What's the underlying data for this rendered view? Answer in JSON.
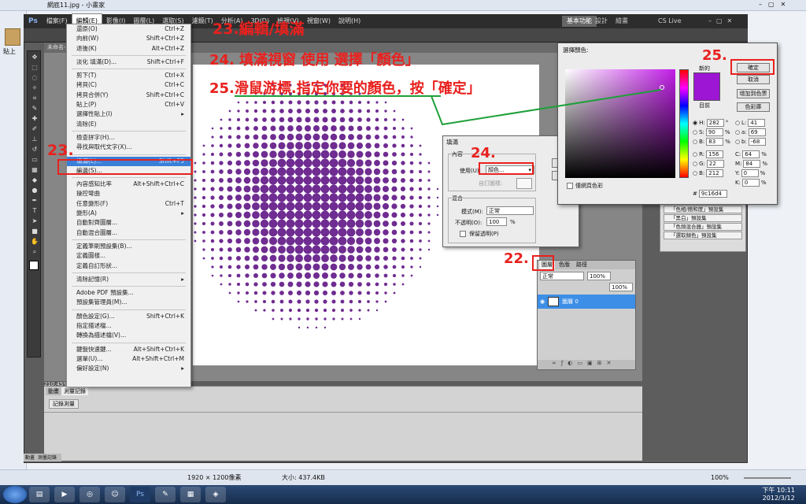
{
  "paint": {
    "title": "網底11.jpg - 小畫家",
    "status_size": "1920 × 1200像素",
    "status_filesize": "大小: 437.4KB",
    "zoom": "100%",
    "paste_label": "貼上"
  },
  "photoshop": {
    "logo": "Ps",
    "menus": [
      "檔案(F)",
      "編輯(E)",
      "影像(I)",
      "圖層(L)",
      "選取(S)",
      "濾鏡(T)",
      "分析(A)",
      "3D(D)",
      "檢視(V)",
      "視窗(W)",
      "說明(H)"
    ],
    "workspaces": [
      "基本功能",
      "設計",
      "繪畫"
    ],
    "cslive": "CS Live",
    "doc_tab": "未命名-1",
    "zoom_status": "210.45%",
    "lower_tabs": [
      "動畫",
      "測量記錄"
    ],
    "record_label": "記錄測量",
    "bottom_tabs": [
      "動畫",
      "測量記錄"
    ]
  },
  "edit_menu": [
    {
      "label": "還原(O)",
      "shortcut": "Ctrl+Z"
    },
    {
      "label": "向前(W)",
      "shortcut": "Shift+Ctrl+Z"
    },
    {
      "label": "退後(K)",
      "shortcut": "Alt+Ctrl+Z"
    },
    {
      "sep": true
    },
    {
      "label": "淡化 填滿(D)...",
      "shortcut": "Shift+Ctrl+F"
    },
    {
      "sep": true
    },
    {
      "label": "剪下(T)",
      "shortcut": "Ctrl+X"
    },
    {
      "label": "拷貝(C)",
      "shortcut": "Ctrl+C"
    },
    {
      "label": "拷貝合併(Y)",
      "shortcut": "Shift+Ctrl+C"
    },
    {
      "label": "貼上(P)",
      "shortcut": "Ctrl+V"
    },
    {
      "label": "選擇性貼上(I)",
      "shortcut": "▸"
    },
    {
      "label": "清除(E)",
      "shortcut": ""
    },
    {
      "sep": true
    },
    {
      "label": "檢查拼字(H)...",
      "shortcut": ""
    },
    {
      "label": "尋找與取代文字(X)...",
      "shortcut": ""
    },
    {
      "sep": true
    },
    {
      "label": "填滿(L)...",
      "shortcut": "Shift+F5",
      "highlight": true
    },
    {
      "label": "編邊(S)...",
      "shortcut": ""
    },
    {
      "sep": true
    },
    {
      "label": "內容感知比率",
      "shortcut": "Alt+Shift+Ctrl+C"
    },
    {
      "label": "操控彎曲",
      "shortcut": ""
    },
    {
      "label": "任意變形(F)",
      "shortcut": "Ctrl+T"
    },
    {
      "label": "變形(A)",
      "shortcut": "▸"
    },
    {
      "label": "自動對齊圖層...",
      "shortcut": ""
    },
    {
      "label": "自動混合圖層...",
      "shortcut": ""
    },
    {
      "sep": true
    },
    {
      "label": "定義筆刷預設集(B)...",
      "shortcut": ""
    },
    {
      "label": "定義圖樣...",
      "shortcut": ""
    },
    {
      "label": "定義自訂形狀...",
      "shortcut": ""
    },
    {
      "sep": true
    },
    {
      "label": "清除記憶(R)",
      "shortcut": "▸"
    },
    {
      "sep": true
    },
    {
      "label": "Adobe PDF 預設集...",
      "shortcut": ""
    },
    {
      "label": "預設集管理員(M)...",
      "shortcut": ""
    },
    {
      "sep": true
    },
    {
      "label": "顏色設定(G)...",
      "shortcut": "Shift+Ctrl+K"
    },
    {
      "label": "指定描述檔...",
      "shortcut": ""
    },
    {
      "label": "轉換為描述檔(V)...",
      "shortcut": ""
    },
    {
      "sep": true
    },
    {
      "label": "鍵盤快速鍵...",
      "shortcut": "Alt+Shift+Ctrl+K"
    },
    {
      "label": "選單(U)...",
      "shortcut": "Alt+Shift+Ctrl+M"
    },
    {
      "label": "偏好設定(N)",
      "shortcut": "▸"
    }
  ],
  "fill_dialog": {
    "title": "填滿",
    "content_group": "內容",
    "use_label": "使用(U):",
    "use_value": "顏色...",
    "custom_pattern": "自訂圖樣:",
    "blend_group": "混合",
    "mode_label": "模式(M):",
    "mode_value": "正常",
    "opacity_label": "不透明(O):",
    "opacity_value": "100",
    "opacity_unit": "%",
    "preserve_label": "保留透明(P)",
    "ok": "確定",
    "cancel": "取消"
  },
  "color_picker": {
    "title": "選擇顏色:",
    "new_label": "新的",
    "current_label": "目前",
    "new_color": "#9c16d4",
    "ok": "確定",
    "cancel": "取消",
    "add_swatch": "增加到色票",
    "libraries": "色彩庫",
    "web_only": "僅網頁色彩",
    "h": "282",
    "s": "90",
    "b": "83",
    "r": "156",
    "g": "22",
    "bl": "212",
    "l": "41",
    "a": "69",
    "lab_b": "-68",
    "c": "64",
    "m": "84",
    "y": "0",
    "k": "0",
    "hex": "9c16d4",
    "deg": "°",
    "pct": "%"
  },
  "layers_panel": {
    "tabs": [
      "圖層",
      "色版",
      "路徑"
    ],
    "blend": "正常",
    "opacity": "100%",
    "fill": "100%",
    "layer_name": "圖層 0"
  },
  "preset_list": [
    "「色相/飽和度」預設集",
    "「黑白」預設集",
    "「色頻混合器」預設集",
    "「選取顏色」預設集"
  ],
  "annotations": {
    "step23_title": "23.編輯/填滿",
    "step24_text": "24. 填滿視窗 使用 選擇「顏色」",
    "step25_text": "25.滑鼠游標.指定你要的顏色，按「確定」",
    "n22": "22.",
    "n23": "23.",
    "n24": "24.",
    "n25": "25."
  },
  "taskbar": {
    "time": "下午 10:11",
    "date": "2012/3/12"
  },
  "dot_color": "#6f2c91"
}
